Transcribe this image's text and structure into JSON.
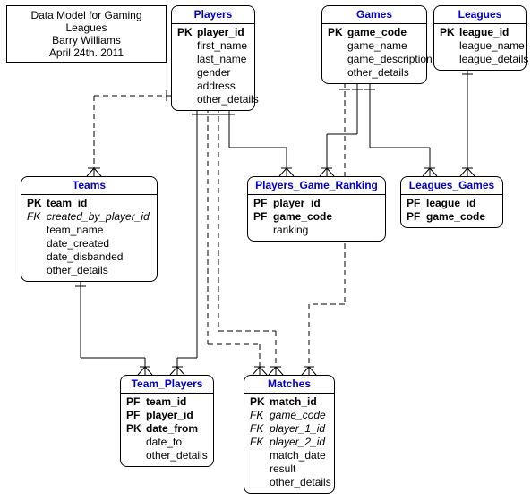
{
  "info": {
    "line1": "Data Model for Gaming Leagues",
    "line2": "Barry Williams",
    "line3": "April 24th. 2011"
  },
  "entities": {
    "players": {
      "title": "Players",
      "rows": [
        {
          "key": "PK",
          "kb": true,
          "name": "player_id",
          "bold": true
        },
        {
          "key": "",
          "name": "first_name"
        },
        {
          "key": "",
          "name": "last_name"
        },
        {
          "key": "",
          "name": "gender"
        },
        {
          "key": "",
          "name": "address"
        },
        {
          "key": "",
          "name": "other_details"
        }
      ]
    },
    "games": {
      "title": "Games",
      "rows": [
        {
          "key": "PK",
          "kb": true,
          "name": "game_code",
          "bold": true
        },
        {
          "key": "",
          "name": "game_name"
        },
        {
          "key": "",
          "name": "game_description"
        },
        {
          "key": "",
          "name": "other_details"
        }
      ]
    },
    "leagues": {
      "title": "Leagues",
      "rows": [
        {
          "key": "PK",
          "kb": true,
          "name": "league_id",
          "bold": true
        },
        {
          "key": "",
          "name": "league_name"
        },
        {
          "key": "",
          "name": "league_details"
        }
      ]
    },
    "teams": {
      "title": "Teams",
      "rows": [
        {
          "key": "PK",
          "kb": true,
          "name": "team_id",
          "bold": true
        },
        {
          "key": "FK",
          "fk": true,
          "name": "created_by_player_id",
          "italic": true
        },
        {
          "key": "",
          "name": "team_name"
        },
        {
          "key": "",
          "name": "date_created"
        },
        {
          "key": "",
          "name": "date_disbanded"
        },
        {
          "key": "",
          "name": "other_details"
        }
      ]
    },
    "pgr": {
      "title": "Players_Game_Ranking",
      "rows": [
        {
          "key": "PF",
          "kb": true,
          "name": "player_id",
          "bold": true
        },
        {
          "key": "PF",
          "kb": true,
          "name": "game_code",
          "bold": true
        },
        {
          "key": "",
          "name": "ranking"
        }
      ]
    },
    "lg": {
      "title": "Leagues_Games",
      "rows": [
        {
          "key": "PF",
          "kb": true,
          "name": "league_id",
          "bold": true
        },
        {
          "key": "PF",
          "kb": true,
          "name": "game_code",
          "bold": true
        }
      ]
    },
    "tp": {
      "title": "Team_Players",
      "rows": [
        {
          "key": "PF",
          "kb": true,
          "name": "team_id",
          "bold": true
        },
        {
          "key": "PF",
          "kb": true,
          "name": "player_id",
          "bold": true
        },
        {
          "key": "PK",
          "kb": true,
          "name": "date_from",
          "bold": true
        },
        {
          "key": "",
          "name": "date_to"
        },
        {
          "key": "",
          "name": "other_details"
        }
      ]
    },
    "matches": {
      "title": "Matches",
      "rows": [
        {
          "key": "PK",
          "kb": true,
          "name": "match_id",
          "bold": true
        },
        {
          "key": "FK",
          "fk": true,
          "name": "game_code",
          "italic": true
        },
        {
          "key": "FK",
          "fk": true,
          "name": "player_1_id",
          "italic": true
        },
        {
          "key": "FK",
          "fk": true,
          "name": "player_2_id",
          "italic": true
        },
        {
          "key": "",
          "name": "match_date"
        },
        {
          "key": "",
          "name": "result"
        },
        {
          "key": "",
          "name": "other_details"
        }
      ]
    }
  }
}
